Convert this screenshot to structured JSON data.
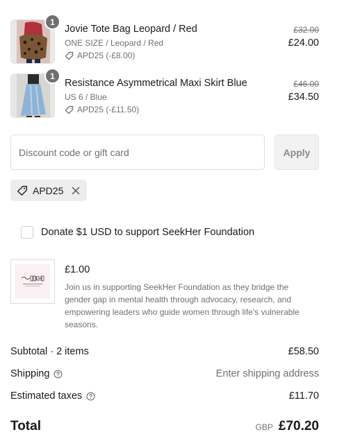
{
  "items": [
    {
      "title": "Jovie Tote Bag Leopard / Red",
      "variant": "ONE SIZE / Leopard / Red",
      "discount": "APD25 (-£8.00)",
      "original_price": "£32.00",
      "price": "£24.00",
      "quantity": "1"
    },
    {
      "title": "Resistance Asymmetrical Maxi Skirt Blue",
      "variant": "US 6 / Blue",
      "discount": "APD25 (-£11.50)",
      "original_price": "£46.00",
      "price": "£34.50",
      "quantity": "1"
    }
  ],
  "discount_form": {
    "placeholder": "Discount code or gift card",
    "apply_label": "Apply"
  },
  "applied_code": "APD25",
  "donation": {
    "label": "Donate $1 USD to support SeekHer Foundation",
    "price": "£1.00",
    "description": "Join us in supporting SeekHer Foundation as they bridge the gender gap in mental health through advocacy, research, and empowering leaders who guide women through life's vulnerable seasons."
  },
  "summary": {
    "subtotal_label": "Subtotal · 2 items",
    "subtotal_value": "£58.50",
    "shipping_label": "Shipping",
    "shipping_value": "Enter shipping address",
    "taxes_label": "Estimated taxes",
    "taxes_value": "£11.70",
    "total_label": "Total",
    "total_currency": "GBP",
    "total_value": "£70.20"
  },
  "colors": {
    "text": "#1a1a1a",
    "muted": "#707070",
    "badge": "#707070",
    "chip_bg": "#ededed"
  }
}
